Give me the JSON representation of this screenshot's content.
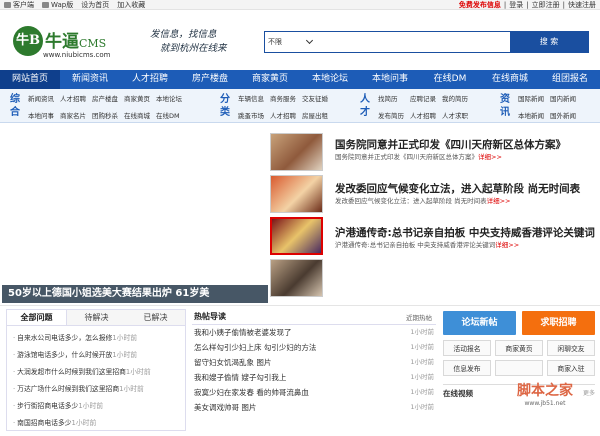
{
  "topbar": {
    "left": [
      "客户端",
      "Wap版",
      "设为首页",
      "加入收藏"
    ],
    "post_free": "免费发布信息",
    "right": [
      "|",
      "登录",
      "|",
      "立即注册",
      "|",
      "快速注册"
    ]
  },
  "logo": {
    "circle": "牛B",
    "name": "牛逼",
    "cms": "CMS",
    "url": "www.niubicms.com"
  },
  "slogan": [
    "发信息，找信息",
    "就到杭州在线来"
  ],
  "search": {
    "select": "不限",
    "button": "搜 索"
  },
  "nav": [
    "网站首页",
    "新闻资讯",
    "人才招聘",
    "房产楼盘",
    "商家黄页",
    "本地论坛",
    "本地问事",
    "在线DM",
    "在线商城",
    "组团报名"
  ],
  "subnav": [
    {
      "tag": "综合",
      "rows": [
        [
          "新闻资讯",
          "人才招聘",
          "房产楼盘",
          "商家黄页",
          "本地论坛"
        ],
        [
          "本地问事",
          "商家名片",
          "团购秒杀",
          "在线商城",
          "在线DM"
        ]
      ]
    },
    {
      "tag": "分类",
      "rows": [
        [
          "车辆信息",
          "商务服务",
          "交友征婚"
        ],
        [
          "跳蚤市场",
          "人才招聘",
          "房屋出租"
        ]
      ]
    },
    {
      "tag": "人才",
      "rows": [
        [
          "找简历",
          "应聘记录",
          "我的简历"
        ],
        [
          "发布简历",
          "人才招聘",
          "人才求职"
        ]
      ]
    },
    {
      "tag": "资讯",
      "rows": [
        [
          "国际新闻",
          "国内新闻"
        ],
        [
          "本地新闻",
          "国外新闻"
        ]
      ]
    }
  ],
  "gallery": {
    "caption": "50岁以上德国小姐选美大赛结果出炉 61岁美"
  },
  "news": [
    {
      "h": "国务院同意并正式印发《四川天府新区总体方案》",
      "s": "国务院同意并正式印发《四川天府新区总体方案》",
      "more": "详细>>"
    },
    {
      "h": "发改委回应气候变化立法，进入起草阶段 尚无时间表",
      "s": "发改委回应气候变化立法：进入起草阶段 尚无时间表",
      "more": "详细>>"
    },
    {
      "h": "沪港通传奇:总书记亲自拍板 中央支持威香港评论关键词",
      "s": "沪港通传奇:总书记亲自拍板 中央支持威香港评论关键词",
      "more": "详细>>"
    }
  ],
  "ask": {
    "tabs": [
      "全部问题",
      "待解决",
      "已解决"
    ],
    "items": [
      {
        "q": "自来水公司电话多少，怎么报修",
        "t": "1小时前"
      },
      {
        "q": "游泳馆电话多少，什么时候开放",
        "t": "1小时前"
      },
      {
        "q": "大润发超市什么时候到我们这里招商",
        "t": "1小时前"
      },
      {
        "q": "万达广场什么时候到我们这里招商",
        "t": "1小时前"
      },
      {
        "q": "步行街招商电话多少",
        "t": "1小时前"
      },
      {
        "q": "南国招商电话多少",
        "t": "1小时前"
      }
    ]
  },
  "hot": {
    "title": "热帖导读",
    "corner": "近期热帖",
    "items": [
      {
        "t": "我和小姨子偷情被老婆发现了",
        "a": "1小时前"
      },
      {
        "t": "怎么样勾引少妇上床 勾引少妇的方法",
        "a": "1小时前"
      },
      {
        "t": "留守妇女饥渴乱象 图片",
        "a": "1小时前"
      },
      {
        "t": "我和嫂子偷情 嫂子勾引我上",
        "a": "1小时前"
      },
      {
        "t": "寂寞少妇在家发春 看的帅哥流鼻血",
        "a": "1小时前"
      },
      {
        "t": "美女调戏帅哥 图片",
        "a": "1小时前"
      }
    ]
  },
  "side": {
    "big": [
      "论坛新帖",
      "求职招聘"
    ],
    "grid": [
      "活动报名",
      "商家黄页",
      "闲聊交友",
      "信息发布",
      "",
      "商家入驻"
    ],
    "online": "在线视频",
    "more": "更多"
  },
  "watermark": {
    "main": "脚本之家",
    "sub": "www.jb51.net"
  }
}
